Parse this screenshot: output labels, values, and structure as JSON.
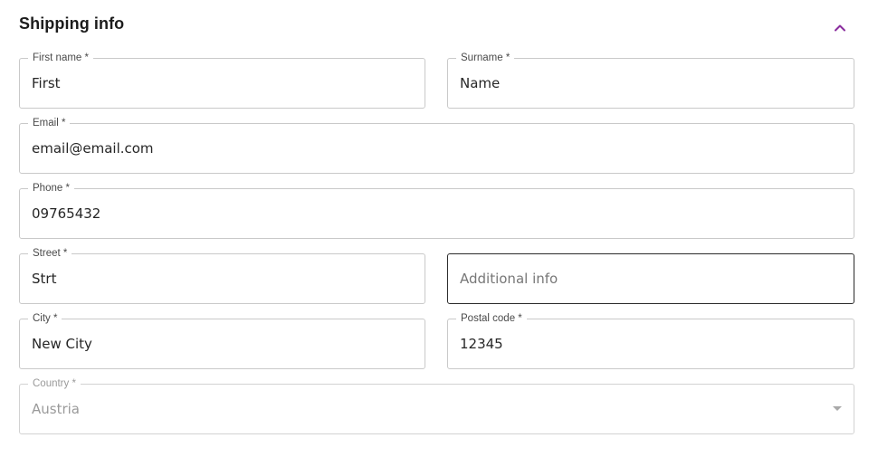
{
  "section": {
    "title": "Shipping info",
    "toggle_icon": "chevron-up-icon",
    "accent_color": "#8a2d9e"
  },
  "fields": {
    "first_name": {
      "label": "First name *",
      "value": "First"
    },
    "surname": {
      "label": "Surname *",
      "value": "Name"
    },
    "email": {
      "label": "Email *",
      "value": "email@email.com"
    },
    "phone": {
      "label": "Phone *",
      "value": "09765432"
    },
    "street": {
      "label": "Street *",
      "value": "Strt"
    },
    "additional_info": {
      "placeholder": "Additional info",
      "value": ""
    },
    "city": {
      "label": "City *",
      "value": "New City"
    },
    "postal_code": {
      "label": "Postal code *",
      "value": "12345"
    },
    "country": {
      "label": "Country *",
      "value": "Austria",
      "disabled": true
    }
  }
}
